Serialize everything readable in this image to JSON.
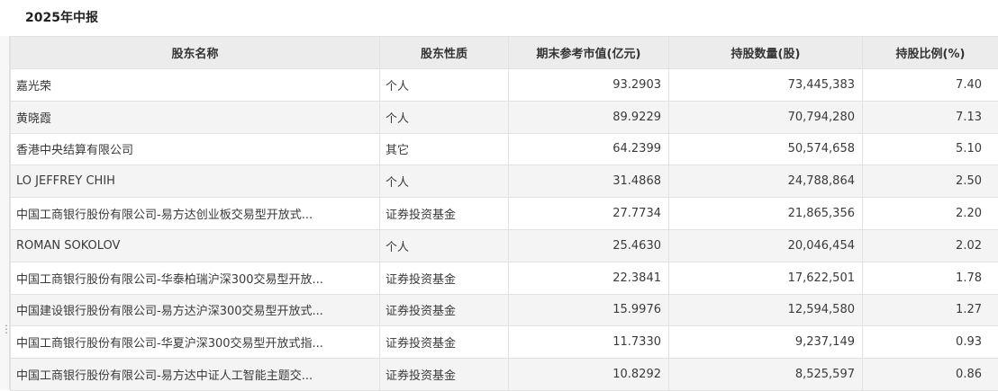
{
  "report": {
    "title": "2025年中报"
  },
  "table": {
    "headers": {
      "name": "股东名称",
      "type": "股东性质",
      "value": "期末参考市值(亿元)",
      "shares": "持股数量(股)",
      "ratio": "持股比例(%)"
    },
    "rows": [
      {
        "name": "嘉光荣",
        "type": "个人",
        "value": "93.2903",
        "shares": "73,445,383",
        "ratio": "7.40"
      },
      {
        "name": "黄晓霞",
        "type": "个人",
        "value": "89.9229",
        "shares": "70,794,280",
        "ratio": "7.13"
      },
      {
        "name": "香港中央结算有限公司",
        "type": "其它",
        "value": "64.2399",
        "shares": "50,574,658",
        "ratio": "5.10"
      },
      {
        "name": "LO JEFFREY CHIH",
        "type": "个人",
        "value": "31.4868",
        "shares": "24,788,864",
        "ratio": "2.50"
      },
      {
        "name": "中国工商银行股份有限公司-易方达创业板交易型开放式...",
        "type": "证券投资基金",
        "value": "27.7734",
        "shares": "21,865,356",
        "ratio": "2.20"
      },
      {
        "name": "ROMAN SOKOLOV",
        "type": "个人",
        "value": "25.4630",
        "shares": "20,046,454",
        "ratio": "2.02"
      },
      {
        "name": "中国工商银行股份有限公司-华泰柏瑞沪深300交易型开放...",
        "type": "证券投资基金",
        "value": "22.3841",
        "shares": "17,622,501",
        "ratio": "1.78"
      },
      {
        "name": "中国建设银行股份有限公司-易方达沪深300交易型开放式...",
        "type": "证券投资基金",
        "value": "15.9976",
        "shares": "12,594,580",
        "ratio": "1.27"
      },
      {
        "name": "中国工商银行股份有限公司-华夏沪深300交易型开放式指...",
        "type": "证券投资基金",
        "value": "11.7330",
        "shares": "9,237,149",
        "ratio": "0.93"
      },
      {
        "name": "中国工商银行股份有限公司-易方达中证人工智能主题交...",
        "type": "证券投资基金",
        "value": "10.8292",
        "shares": "8,525,597",
        "ratio": "0.86"
      }
    ]
  }
}
